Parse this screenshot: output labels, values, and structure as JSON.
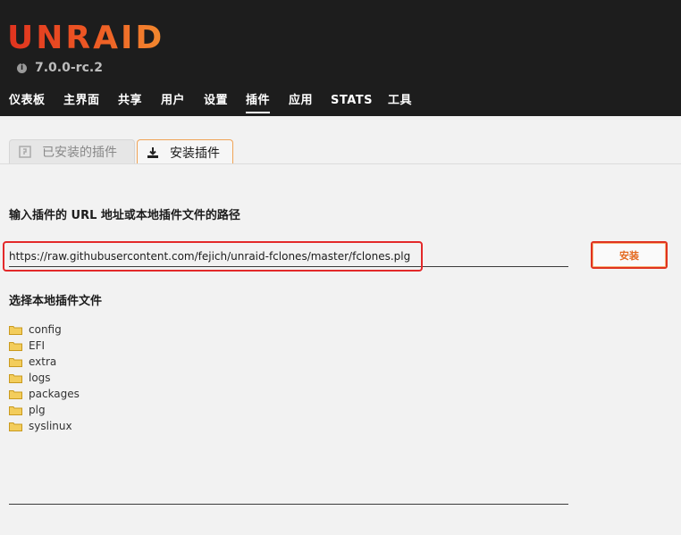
{
  "header": {
    "logo": "UNRAID",
    "version": "7.0.0-rc.2",
    "nav": [
      {
        "label": "仪表板"
      },
      {
        "label": "主界面"
      },
      {
        "label": "共享"
      },
      {
        "label": "用户"
      },
      {
        "label": "设置"
      },
      {
        "label": "插件",
        "active": true
      },
      {
        "label": "应用"
      },
      {
        "label": "STATS"
      },
      {
        "label": "工具"
      }
    ]
  },
  "tabs": [
    {
      "label": "已安装的插件",
      "icon": "puzzle-icon",
      "active": false
    },
    {
      "label": "安装插件",
      "icon": "download-icon",
      "active": true
    }
  ],
  "form": {
    "url_label": "输入插件的 URL 地址或本地插件文件的路径",
    "url_value": "https://raw.githubusercontent.com/fejich/unraid-fclones/master/fclones.plg",
    "install_button": "安装",
    "local_label": "选择本地插件文件"
  },
  "files": [
    {
      "name": "config",
      "icon": "folder-icon"
    },
    {
      "name": "EFI",
      "icon": "folder-icon"
    },
    {
      "name": "extra",
      "icon": "folder-icon"
    },
    {
      "name": "logs",
      "icon": "folder-icon"
    },
    {
      "name": "packages",
      "icon": "folder-icon"
    },
    {
      "name": "plg",
      "icon": "folder-icon"
    },
    {
      "name": "syslinux",
      "icon": "folder-icon"
    }
  ],
  "colors": {
    "header_bg": "#1d1d1d",
    "accent": "#e0331f",
    "highlight": "#e3292a",
    "folder": "#f0c24a"
  }
}
